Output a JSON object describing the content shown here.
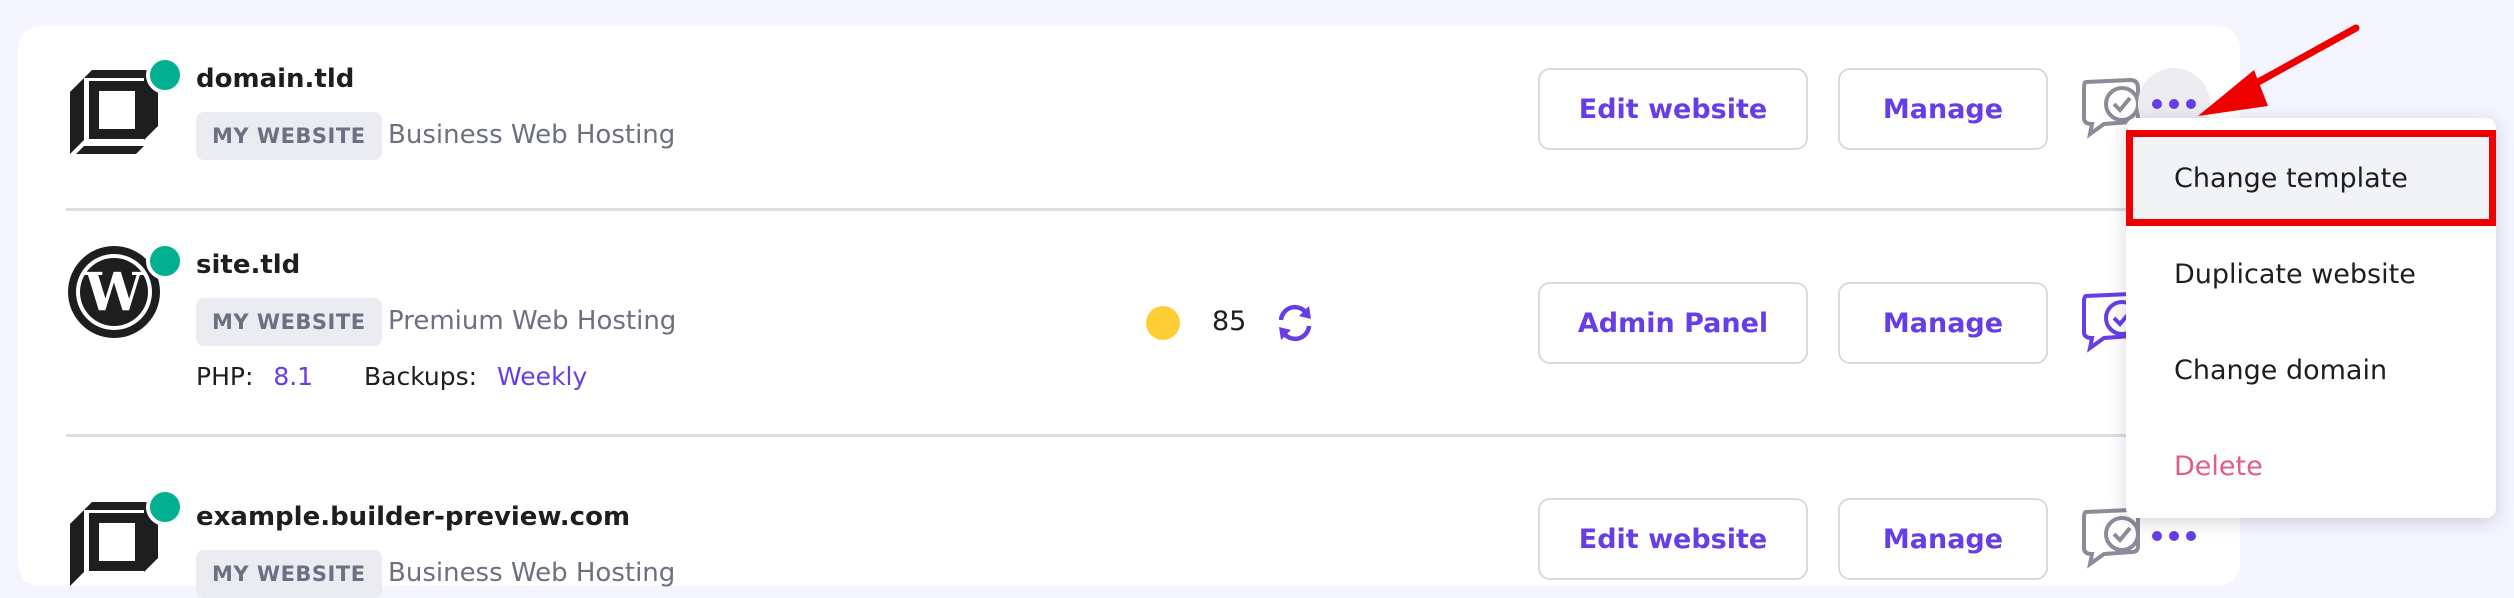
{
  "websites": [
    {
      "domain": "domain.tld",
      "badge": "MY WEBSITE",
      "plan": "Business Web Hosting",
      "primary_action": "Edit website",
      "manage_label": "Manage",
      "logo": "builder-logo-icon"
    },
    {
      "domain": "site.tld",
      "badge": "MY WEBSITE",
      "plan": "Premium Web Hosting",
      "php_label": "PHP:",
      "php_value": "8.1",
      "backups_label": "Backups:",
      "backups_value": "Weekly",
      "score": "85",
      "primary_action": "Admin Panel",
      "manage_label": "Manage",
      "logo": "wordpress-logo-icon"
    },
    {
      "domain": "example.builder-preview.com",
      "badge": "MY WEBSITE",
      "plan": "Business Web Hosting",
      "primary_action": "Edit website",
      "manage_label": "Manage",
      "logo": "builder-logo-icon"
    }
  ],
  "menu": {
    "items": [
      {
        "label": "Change template"
      },
      {
        "label": "Duplicate website"
      },
      {
        "label": "Change domain"
      },
      {
        "label": "Delete"
      }
    ]
  },
  "colors": {
    "accent": "#673de6",
    "status_online": "#00b090",
    "score_dot": "#ffcd35",
    "danger": "#e25c8b",
    "annotation": "#ee0000"
  }
}
